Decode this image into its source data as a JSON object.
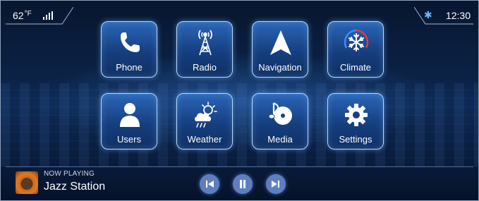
{
  "status": {
    "temperature": "62",
    "temperature_unit": "°F",
    "time": "12:30",
    "bluetooth_icon": "bluetooth-icon",
    "signal_icon": "signal-icon"
  },
  "apps": [
    {
      "label": "Phone",
      "icon": "phone-icon"
    },
    {
      "label": "Radio",
      "icon": "radio-tower-icon"
    },
    {
      "label": "Navigation",
      "icon": "navigation-arrow-icon"
    },
    {
      "label": "Climate",
      "icon": "snowflake-icon"
    },
    {
      "label": "Users",
      "icon": "user-icon"
    },
    {
      "label": "Weather",
      "icon": "weather-icon"
    },
    {
      "label": "Media",
      "icon": "music-disc-icon"
    },
    {
      "label": "Settings",
      "icon": "gear-icon"
    }
  ],
  "now_playing": {
    "label": "NOW PLAYING",
    "title": "Jazz Station"
  },
  "colors": {
    "accent": "#6cb4ff",
    "tile_border": "#b8d8ff",
    "climate_hot": "#e23b3b",
    "climate_cold": "#3d8bff"
  }
}
